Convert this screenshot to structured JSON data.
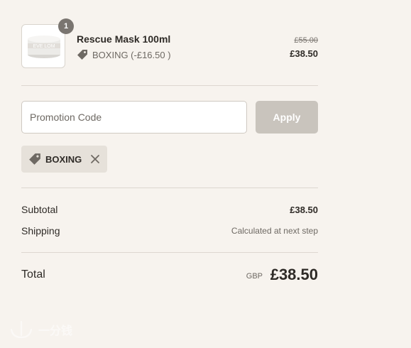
{
  "line_item": {
    "quantity": "1",
    "product_name": "Rescue Mask 100ml",
    "product_image_text": "EVE LOM",
    "discount_text": "BOXING (-£16.50 )",
    "price_original": "£55.00",
    "price_final": "£38.50"
  },
  "promo": {
    "placeholder": "Promotion Code",
    "value": "",
    "apply_label": "Apply",
    "applied_code": "BOXING"
  },
  "totals": {
    "subtotal_label": "Subtotal",
    "subtotal_value": "£38.50",
    "shipping_label": "Shipping",
    "shipping_value": "Calculated at next step",
    "total_label": "Total",
    "total_currency": "GBP",
    "total_value": "£38.50"
  },
  "watermark": {
    "text": "一分钱"
  },
  "colors": {
    "background": "#f7f3ee",
    "apply_button": "#c9c4bd",
    "chip_background": "#e6e1da",
    "badge": "#7a7570",
    "text": "#2f2b27"
  },
  "icons": {
    "discount_tag": "tag-icon",
    "remove": "close-icon",
    "watermark": "anchor-icon"
  }
}
